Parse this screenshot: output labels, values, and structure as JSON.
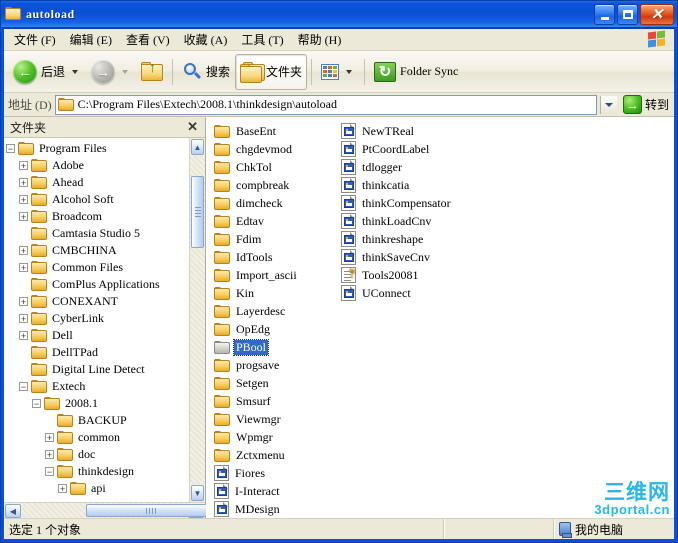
{
  "window": {
    "title": "autoload",
    "title_icon": "folder-icon",
    "buttons": {
      "minimize": "–",
      "maximize": "☐",
      "close": "✕"
    }
  },
  "menubar": {
    "items": [
      {
        "label": "文件 (F)",
        "name": "menu-file"
      },
      {
        "label": "编辑 (E)",
        "name": "menu-edit"
      },
      {
        "label": "查看 (V)",
        "name": "menu-view"
      },
      {
        "label": "收藏 (A)",
        "name": "menu-favorites"
      },
      {
        "label": "工具 (T)",
        "name": "menu-tools"
      },
      {
        "label": "帮助 (H)",
        "name": "menu-help"
      }
    ],
    "logo": "windows-flag-icon"
  },
  "toolbar": {
    "back_label": "后退",
    "forward_label": "",
    "up_label": "",
    "search_label": "搜索",
    "folders_label": "文件夹",
    "views_label": "",
    "folder_sync_label": "Folder Sync"
  },
  "address": {
    "label": "地址 (D)",
    "value": "C:\\Program Files\\Extech\\2008.1\\thinkdesign\\autoload",
    "go_label": "转到"
  },
  "tree": {
    "header": "文件夹",
    "close_label": "✕",
    "items": [
      {
        "label": "Program Files",
        "depth": 0,
        "toggle": "minus"
      },
      {
        "label": "Adobe",
        "depth": 1,
        "toggle": "plus"
      },
      {
        "label": "Ahead",
        "depth": 1,
        "toggle": "plus"
      },
      {
        "label": "Alcohol Soft",
        "depth": 1,
        "toggle": "plus"
      },
      {
        "label": "Broadcom",
        "depth": 1,
        "toggle": "plus"
      },
      {
        "label": "Camtasia Studio 5",
        "depth": 1,
        "toggle": "none"
      },
      {
        "label": "CMBCHINA",
        "depth": 1,
        "toggle": "plus"
      },
      {
        "label": "Common Files",
        "depth": 1,
        "toggle": "plus"
      },
      {
        "label": "ComPlus Applications",
        "depth": 1,
        "toggle": "none"
      },
      {
        "label": "CONEXANT",
        "depth": 1,
        "toggle": "plus"
      },
      {
        "label": "CyberLink",
        "depth": 1,
        "toggle": "plus"
      },
      {
        "label": "Dell",
        "depth": 1,
        "toggle": "plus"
      },
      {
        "label": "DellTPad",
        "depth": 1,
        "toggle": "none"
      },
      {
        "label": "Digital Line Detect",
        "depth": 1,
        "toggle": "none"
      },
      {
        "label": "Extech",
        "depth": 1,
        "toggle": "minus"
      },
      {
        "label": "2008.1",
        "depth": 2,
        "toggle": "minus"
      },
      {
        "label": "BACKUP",
        "depth": 3,
        "toggle": "none"
      },
      {
        "label": "common",
        "depth": 3,
        "toggle": "plus"
      },
      {
        "label": "doc",
        "depth": 3,
        "toggle": "plus"
      },
      {
        "label": "thinkdesign",
        "depth": 3,
        "toggle": "minus"
      },
      {
        "label": "api",
        "depth": 4,
        "toggle": "plus"
      }
    ]
  },
  "filelist": {
    "column1": [
      {
        "label": "BaseEnt",
        "icon": "folder-icon",
        "selected": false
      },
      {
        "label": "chgdevmod",
        "icon": "folder-icon",
        "selected": false
      },
      {
        "label": "ChkTol",
        "icon": "folder-icon",
        "selected": false
      },
      {
        "label": "compbreak",
        "icon": "folder-icon",
        "selected": false
      },
      {
        "label": "dimcheck",
        "icon": "folder-icon",
        "selected": false
      },
      {
        "label": "Edtav",
        "icon": "folder-icon",
        "selected": false
      },
      {
        "label": "Fdim",
        "icon": "folder-icon",
        "selected": false
      },
      {
        "label": "IdTools",
        "icon": "folder-icon",
        "selected": false
      },
      {
        "label": "Import_ascii",
        "icon": "folder-icon",
        "selected": false
      },
      {
        "label": "Kin",
        "icon": "folder-icon",
        "selected": false
      },
      {
        "label": "Layerdesc",
        "icon": "folder-icon",
        "selected": false
      },
      {
        "label": "OpEdg",
        "icon": "folder-icon",
        "selected": false
      },
      {
        "label": "PBool",
        "icon": "folder-icon",
        "selected": true
      },
      {
        "label": "progsave",
        "icon": "folder-icon",
        "selected": false
      },
      {
        "label": "Setgen",
        "icon": "folder-icon",
        "selected": false
      },
      {
        "label": "Smsurf",
        "icon": "folder-icon",
        "selected": false
      },
      {
        "label": "Viewmgr",
        "icon": "folder-icon",
        "selected": false
      },
      {
        "label": "Wpmgr",
        "icon": "folder-icon",
        "selected": false
      },
      {
        "label": "Zctxmenu",
        "icon": "folder-icon",
        "selected": false
      },
      {
        "label": "Fiores",
        "icon": "document-icon",
        "selected": false
      },
      {
        "label": "I-Interact",
        "icon": "document-icon",
        "selected": false
      },
      {
        "label": "MDesign",
        "icon": "document-icon",
        "selected": false
      }
    ],
    "column2": [
      {
        "label": "NewTReal",
        "icon": "document-icon",
        "selected": false
      },
      {
        "label": "PtCoordLabel",
        "icon": "document-icon",
        "selected": false
      },
      {
        "label": "tdlogger",
        "icon": "document-icon",
        "selected": false
      },
      {
        "label": "thinkcatia",
        "icon": "document-icon",
        "selected": false
      },
      {
        "label": "thinkCompensator",
        "icon": "document-icon",
        "selected": false
      },
      {
        "label": "thinkLoadCnv",
        "icon": "document-icon",
        "selected": false
      },
      {
        "label": "thinkreshape",
        "icon": "document-icon",
        "selected": false
      },
      {
        "label": "thinkSaveCnv",
        "icon": "document-icon",
        "selected": false
      },
      {
        "label": "Tools20081",
        "icon": "help-file-icon",
        "selected": false
      },
      {
        "label": "UConnect",
        "icon": "document-icon",
        "selected": false
      }
    ]
  },
  "statusbar": {
    "selection_text": "选定 1 个对象",
    "middle_text": "",
    "location_text": "我的电脑",
    "location_icon": "my-computer-icon"
  },
  "watermark": {
    "cn": "三维网",
    "en": "3dportal.cn"
  },
  "colors": {
    "title_blue": "#0a50d6",
    "selection_blue": "#316ac5",
    "chrome": "#ece9d8",
    "watermark": "#29b6e8"
  }
}
